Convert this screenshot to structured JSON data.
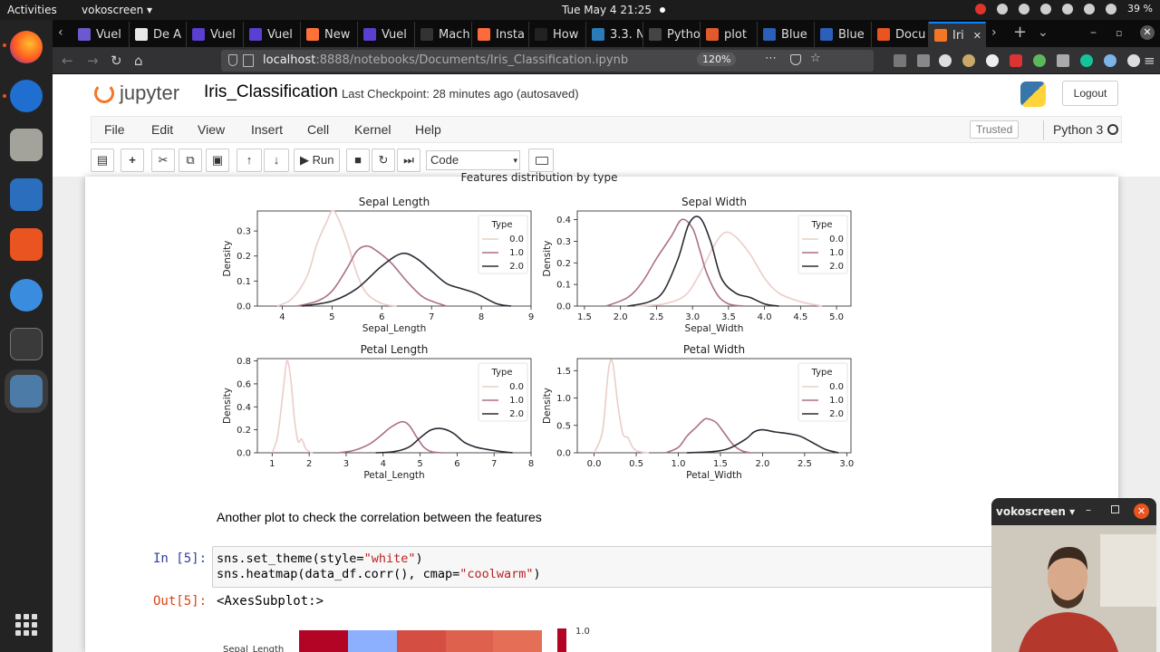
{
  "desktop": {
    "activities": "Activities",
    "app_menu": "vokoscreen ▾",
    "clock": "Tue May 4  21:25",
    "battery": "39 %"
  },
  "browser": {
    "tabs": [
      {
        "label": "Vuel",
        "color": "#6a5acd"
      },
      {
        "label": "De A",
        "color": "#e8e8e8"
      },
      {
        "label": "Vuel",
        "color": "#5b3fd1"
      },
      {
        "label": "Vuel",
        "color": "#5b3fd1"
      },
      {
        "label": "New",
        "color": "#ff7139"
      },
      {
        "label": "Vuel",
        "color": "#5b3fd1"
      },
      {
        "label": "Mach",
        "color": "#333333"
      },
      {
        "label": "Insta",
        "color": "#ff6a3d"
      },
      {
        "label": "How",
        "color": "#222222"
      },
      {
        "label": "3.3. N",
        "color": "#2b7bb9"
      },
      {
        "label": "Pytho",
        "color": "#444444"
      },
      {
        "label": "plot",
        "color": "#e25a2b"
      },
      {
        "label": "Blue",
        "color": "#2b5fb9"
      },
      {
        "label": "Blue",
        "color": "#2b5fb9"
      },
      {
        "label": "Docu",
        "color": "#e95420"
      },
      {
        "label": "Iri",
        "color": "#f37626"
      }
    ],
    "url_host": "localhost",
    "url_path": ":8888/notebooks/Documents/Iris_Classification.ipynb",
    "zoom": "120%"
  },
  "jupyter": {
    "logo_text": "jupyter",
    "notebook_title": "Iris_Classification",
    "checkpoint": "Last Checkpoint: 28 minutes ago   (autosaved)",
    "logout": "Logout",
    "menu": [
      "File",
      "Edit",
      "View",
      "Insert",
      "Cell",
      "Kernel",
      "Help"
    ],
    "trusted": "Trusted",
    "kernel_name": "Python 3",
    "run_label": "Run",
    "cell_type": "Code"
  },
  "notebook": {
    "figure_title": "Features distribution by type",
    "markdown": "Another plot to check the correlation between the features",
    "in_prompt": "In [5]:",
    "code_line1_a": "sns.set_theme(style=",
    "code_line1_str": "\"white\"",
    "code_line1_b": ")",
    "code_line2_a": "sns.heatmap(data_df.corr(), cmap=",
    "code_line2_str": "\"coolwarm\"",
    "code_line2_b": ")",
    "out_prompt": "Out[5]:",
    "output_text": "<AxesSubplot:>",
    "heatmap_row_label": "Sepal_Length",
    "colorbar_max": "1.0"
  },
  "chart_data": [
    {
      "type": "line",
      "title": "Sepal Length",
      "xlabel": "Sepal_Length",
      "ylabel": "Density",
      "xlim": [
        3.5,
        9.0
      ],
      "ylim": [
        0,
        0.38
      ],
      "xticks": [
        "4",
        "5",
        "6",
        "7",
        "8",
        "9"
      ],
      "yticks": [
        "0.0",
        "0.1",
        "0.2",
        "0.3"
      ],
      "legend_title": "Type",
      "legend_position": "top-right",
      "series": [
        {
          "name": "0.0",
          "color": "#ebcdc9",
          "x": [
            3.9,
            4.2,
            4.5,
            4.7,
            4.9,
            5.0,
            5.1,
            5.3,
            5.5,
            5.7,
            6.0,
            6.3
          ],
          "y": [
            0.0,
            0.03,
            0.12,
            0.25,
            0.34,
            0.38,
            0.36,
            0.26,
            0.13,
            0.05,
            0.01,
            0.0
          ]
        },
        {
          "name": "1.0",
          "color": "#ad6f86",
          "x": [
            4.3,
            4.7,
            5.0,
            5.3,
            5.5,
            5.7,
            5.9,
            6.2,
            6.5,
            6.8,
            7.0,
            7.3
          ],
          "y": [
            0.0,
            0.02,
            0.06,
            0.15,
            0.22,
            0.24,
            0.22,
            0.17,
            0.1,
            0.04,
            0.02,
            0.0
          ]
        },
        {
          "name": "2.0",
          "color": "#2d2a35",
          "x": [
            4.4,
            5.0,
            5.5,
            6.0,
            6.4,
            6.7,
            7.0,
            7.3,
            7.6,
            7.9,
            8.3,
            8.6
          ],
          "y": [
            0.0,
            0.02,
            0.07,
            0.16,
            0.21,
            0.19,
            0.14,
            0.09,
            0.07,
            0.05,
            0.01,
            0.0
          ]
        }
      ]
    },
    {
      "type": "line",
      "title": "Sepal Width",
      "xlabel": "Sepal_Width",
      "ylabel": "Density",
      "xlim": [
        1.4,
        5.2
      ],
      "ylim": [
        0,
        0.44
      ],
      "xticks": [
        "1.5",
        "2.0",
        "2.5",
        "3.0",
        "3.5",
        "4.0",
        "4.5",
        "5.0"
      ],
      "yticks": [
        "0.0",
        "0.1",
        "0.2",
        "0.3",
        "0.4"
      ],
      "legend_title": "Type",
      "legend_position": "top-right",
      "series": [
        {
          "name": "0.0",
          "color": "#ebcdc9",
          "x": [
            2.2,
            2.6,
            2.9,
            3.1,
            3.3,
            3.45,
            3.6,
            3.8,
            4.0,
            4.2,
            4.5,
            4.8
          ],
          "y": [
            0.0,
            0.01,
            0.05,
            0.15,
            0.28,
            0.34,
            0.32,
            0.24,
            0.13,
            0.06,
            0.02,
            0.0
          ]
        },
        {
          "name": "1.0",
          "color": "#ad6f86",
          "x": [
            1.8,
            2.1,
            2.3,
            2.5,
            2.7,
            2.85,
            3.0,
            3.1,
            3.2,
            3.35,
            3.5,
            3.7
          ],
          "y": [
            0.0,
            0.04,
            0.11,
            0.22,
            0.32,
            0.4,
            0.36,
            0.26,
            0.15,
            0.05,
            0.01,
            0.0
          ]
        },
        {
          "name": "2.0",
          "color": "#2d2a35",
          "x": [
            2.1,
            2.4,
            2.6,
            2.8,
            2.95,
            3.1,
            3.25,
            3.4,
            3.6,
            3.8,
            4.0,
            4.2
          ],
          "y": [
            0.0,
            0.02,
            0.07,
            0.22,
            0.38,
            0.41,
            0.3,
            0.13,
            0.06,
            0.04,
            0.01,
            0.0
          ]
        }
      ]
    },
    {
      "type": "line",
      "title": "Petal Length",
      "xlabel": "Petal_Length",
      "ylabel": "Density",
      "xlim": [
        0.6,
        8.0
      ],
      "ylim": [
        0,
        0.82
      ],
      "xticks": [
        "1",
        "2",
        "3",
        "4",
        "5",
        "6",
        "7",
        "8"
      ],
      "yticks": [
        "0.0",
        "0.2",
        "0.4",
        "0.6",
        "0.8"
      ],
      "legend_title": "Type",
      "legend_position": "top-right",
      "series": [
        {
          "name": "0.0",
          "color": "#ebcdc9",
          "x": [
            1.0,
            1.15,
            1.3,
            1.4,
            1.5,
            1.6,
            1.7,
            1.8,
            1.9,
            2.0,
            2.1
          ],
          "y": [
            0.0,
            0.15,
            0.55,
            0.8,
            0.65,
            0.3,
            0.1,
            0.12,
            0.04,
            0.01,
            0.0
          ]
        },
        {
          "name": "1.0",
          "color": "#ad6f86",
          "x": [
            2.8,
            3.2,
            3.6,
            3.9,
            4.2,
            4.5,
            4.7,
            4.9,
            5.1,
            5.3,
            5.6
          ],
          "y": [
            0.0,
            0.02,
            0.07,
            0.14,
            0.22,
            0.27,
            0.24,
            0.14,
            0.05,
            0.01,
            0.0
          ]
        },
        {
          "name": "2.0",
          "color": "#2d2a35",
          "x": [
            3.8,
            4.3,
            4.7,
            5.0,
            5.3,
            5.6,
            5.9,
            6.2,
            6.5,
            6.8,
            7.2,
            7.5
          ],
          "y": [
            0.0,
            0.01,
            0.05,
            0.13,
            0.2,
            0.21,
            0.17,
            0.09,
            0.05,
            0.03,
            0.01,
            0.0
          ]
        }
      ]
    },
    {
      "type": "line",
      "title": "Petal Width",
      "xlabel": "Petal_Width",
      "ylabel": "Density",
      "xlim": [
        -0.2,
        3.05
      ],
      "ylim": [
        0,
        1.72
      ],
      "xticks": [
        "0.0",
        "0.5",
        "1.0",
        "1.5",
        "2.0",
        "2.5",
        "3.0"
      ],
      "yticks": [
        "0.0",
        "0.5",
        "1.0",
        "1.5"
      ],
      "legend_title": "Type",
      "legend_position": "top-right",
      "series": [
        {
          "name": "0.0",
          "color": "#ebcdc9",
          "x": [
            0.0,
            0.1,
            0.17,
            0.22,
            0.28,
            0.34,
            0.4,
            0.45,
            0.5,
            0.58,
            0.65
          ],
          "y": [
            0.0,
            0.4,
            1.5,
            1.65,
            0.9,
            0.35,
            0.28,
            0.12,
            0.04,
            0.01,
            0.0
          ]
        },
        {
          "name": "1.0",
          "color": "#ad6f86",
          "x": [
            0.85,
            1.0,
            1.1,
            1.2,
            1.3,
            1.35,
            1.45,
            1.55,
            1.65,
            1.75,
            1.85
          ],
          "y": [
            0.0,
            0.1,
            0.3,
            0.45,
            0.6,
            0.62,
            0.55,
            0.35,
            0.15,
            0.04,
            0.0
          ]
        },
        {
          "name": "2.0",
          "color": "#2d2a35",
          "x": [
            1.1,
            1.4,
            1.6,
            1.8,
            1.9,
            2.0,
            2.15,
            2.3,
            2.45,
            2.6,
            2.75,
            2.9
          ],
          "y": [
            0.0,
            0.02,
            0.08,
            0.25,
            0.38,
            0.42,
            0.38,
            0.35,
            0.3,
            0.18,
            0.06,
            0.0
          ]
        }
      ]
    }
  ]
}
